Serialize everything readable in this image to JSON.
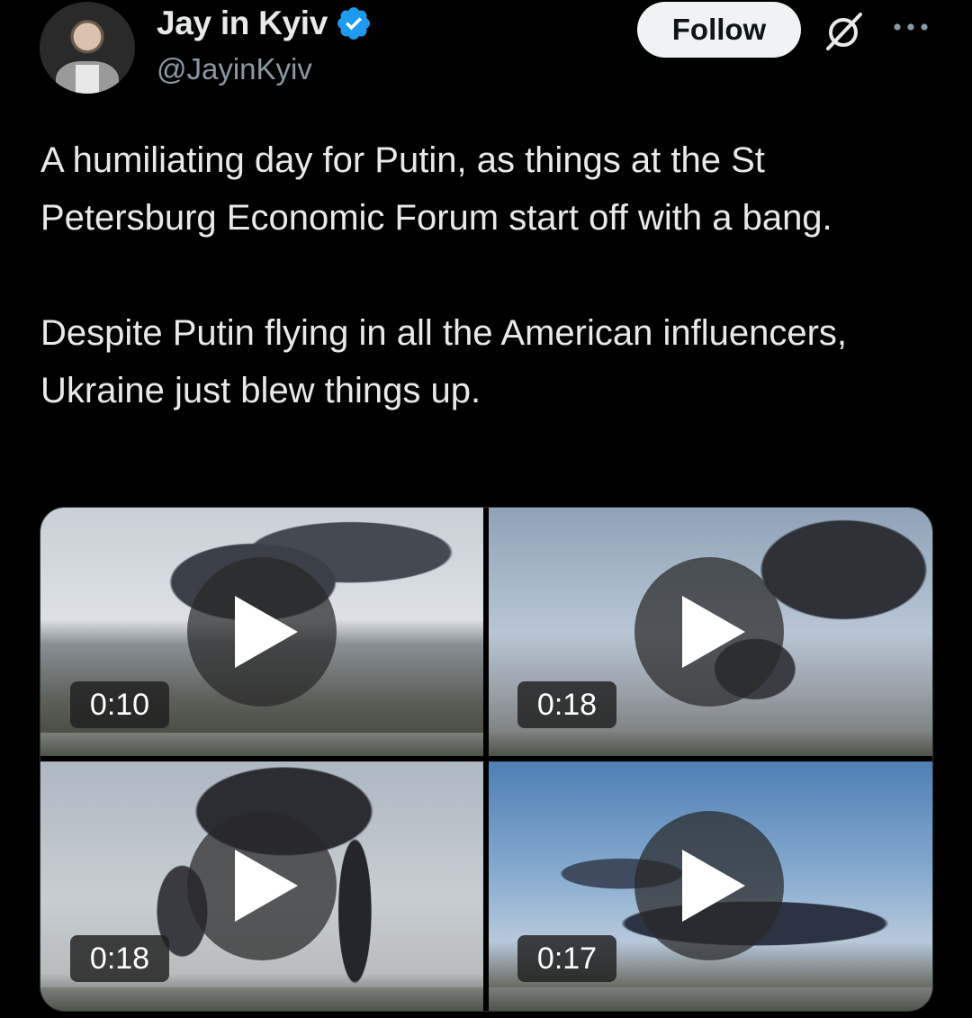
{
  "author": {
    "display_name": "Jay in Kyiv",
    "handle": "@JayinKyiv",
    "verified": true,
    "verified_color": "#1d9bf0"
  },
  "actions": {
    "follow_label": "Follow",
    "grok_icon": "grok-icon",
    "more_icon": "more-icon"
  },
  "tweet": {
    "paragraphs": [
      "A humiliating day for Putin, as things at the St Petersburg Economic Forum start off with a bang.",
      "Despite Putin flying in all the American influencers, Ukraine just blew things up."
    ]
  },
  "media": [
    {
      "type": "video",
      "duration": "0:10"
    },
    {
      "type": "video",
      "duration": "0:18"
    },
    {
      "type": "video",
      "duration": "0:18"
    },
    {
      "type": "video",
      "duration": "0:17"
    }
  ],
  "colors": {
    "background": "#000000",
    "text": "#e7e9ea",
    "secondary_text": "#8b98a5",
    "follow_button_bg": "#eff3f4"
  }
}
